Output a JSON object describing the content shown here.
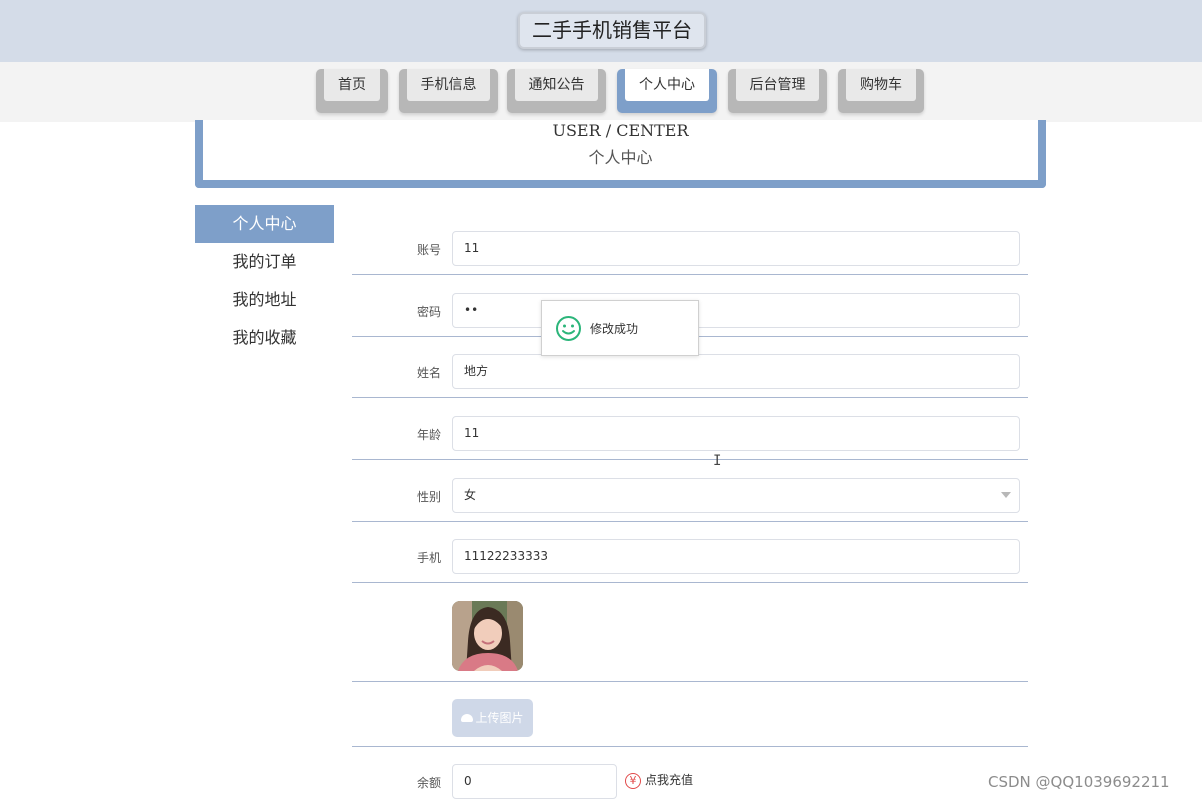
{
  "header": {
    "title": "二手手机销售平台"
  },
  "nav": [
    {
      "label": "首页"
    },
    {
      "label": "手机信息"
    },
    {
      "label": "通知公告"
    },
    {
      "label": "个人中心"
    },
    {
      "label": "后台管理"
    },
    {
      "label": "购物车"
    }
  ],
  "nav_active": "个人中心",
  "banner": {
    "en": "USER / CENTER",
    "cn": "个人中心"
  },
  "sidebar": [
    {
      "label": "个人中心"
    },
    {
      "label": "我的订单"
    },
    {
      "label": "我的地址"
    },
    {
      "label": "我的收藏"
    }
  ],
  "form": {
    "account": {
      "label": "账号",
      "value": "11"
    },
    "password": {
      "label": "密码",
      "value": "••"
    },
    "name": {
      "label": "姓名",
      "value": "地方"
    },
    "age": {
      "label": "年龄",
      "value": "11"
    },
    "gender": {
      "label": "性别",
      "value": "女"
    },
    "phone": {
      "label": "手机",
      "value": "11122233333"
    },
    "upload_label": "上传图片",
    "balance": {
      "label": "余额",
      "value": "0"
    },
    "recharge_label": "点我充值"
  },
  "toast": {
    "message": "修改成功",
    "icon": "smile-icon"
  },
  "watermark": "CSDN @QQ1039692211",
  "colors": {
    "accent": "#7e9fc9",
    "topbar": "#d4dce8",
    "toast_icon": "#2bb57a",
    "yen": "#e24b4b"
  }
}
